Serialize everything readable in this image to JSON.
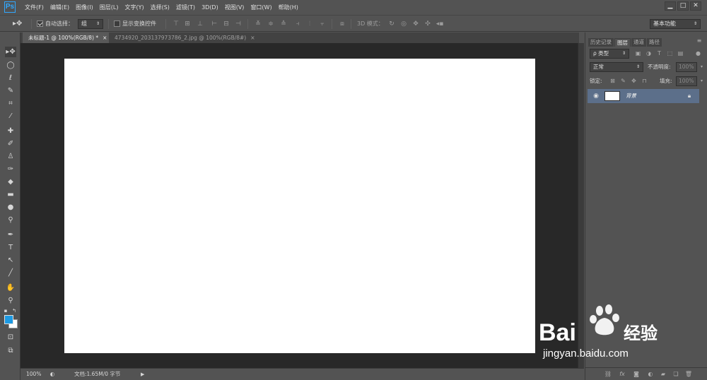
{
  "app": {
    "logo": "Ps"
  },
  "menu": [
    "文件(F)",
    "编辑(E)",
    "图像(I)",
    "图层(L)",
    "文字(Y)",
    "选择(S)",
    "滤镜(T)",
    "3D(D)",
    "视图(V)",
    "窗口(W)",
    "帮助(H)"
  ],
  "window_controls": {
    "minimize": "▁",
    "restore": "□",
    "close": "✕"
  },
  "options_bar": {
    "auto_select_label": "自动选择：",
    "auto_select_value": "组",
    "show_transform_label": "显示变换控件",
    "mode_3d_label": "3D 模式：",
    "workspace_value": "基本功能"
  },
  "tabs": [
    {
      "label": "未标题-1 @ 100%(RGB/8) *",
      "close": "×"
    },
    {
      "label": "4734920_203137973786_2.jpg @ 100%(RGB/8#)",
      "close": "×"
    }
  ],
  "status": {
    "zoom": "100%",
    "doc_info": "文档:1.65M/0 字节"
  },
  "panel": {
    "tabs": [
      "历史记录",
      "图层",
      "通道",
      "路径"
    ],
    "filter_label": "ρ 类型",
    "blend_mode": "正常",
    "opacity_label": "不透明度:",
    "opacity_value": "100%",
    "lock_label": "锁定:",
    "fill_label": "填充:",
    "fill_value": "100%",
    "layer_name": "背景"
  },
  "watermark": {
    "text": "jingyan.baidu.com",
    "logo_text": "Bai 经验"
  },
  "colors": {
    "foreground": "#1d9ae3",
    "background": "#ffffff"
  }
}
